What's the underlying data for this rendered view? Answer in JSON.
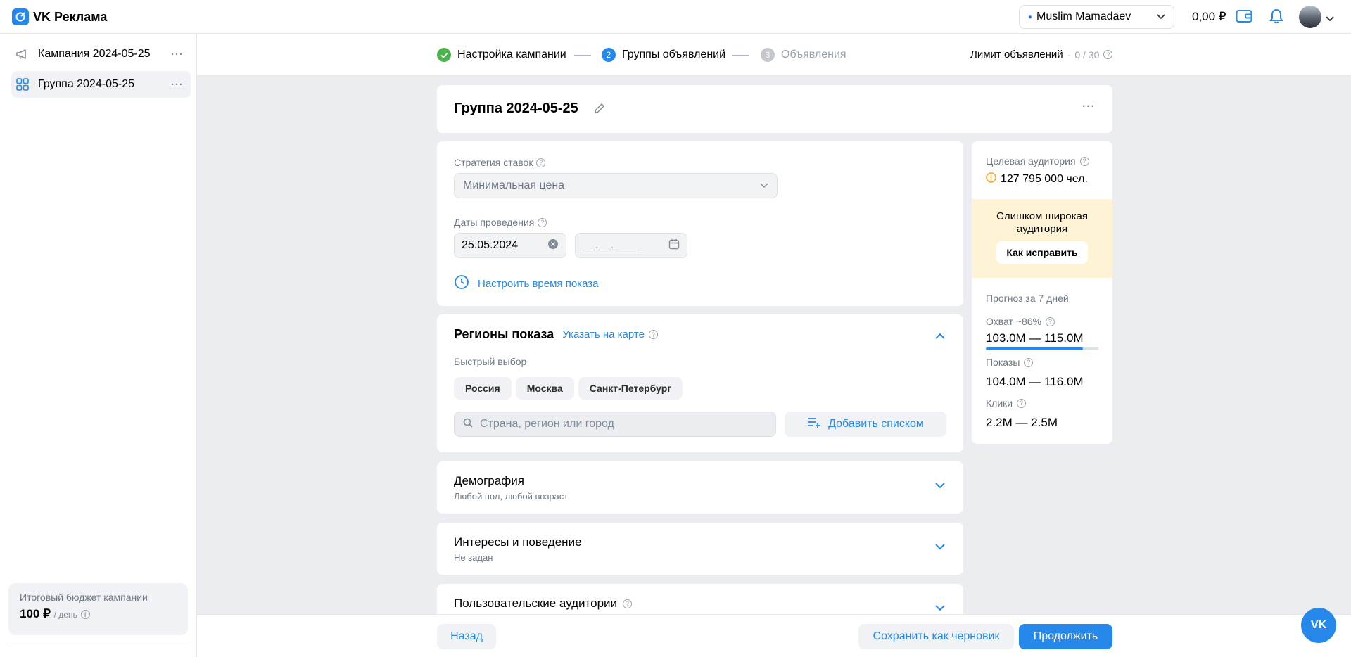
{
  "header": {
    "logo_text": "VK Реклама",
    "account_name": "Muslim Mamadaev",
    "balance": "0,00 ₽"
  },
  "sidebar": {
    "items": [
      {
        "label": "Кампания 2024-05-25",
        "icon": "megaphone-icon"
      },
      {
        "label": "Группа 2024-05-25",
        "icon": "grid-icon"
      }
    ],
    "budget_label": "Итоговый бюджет кампании",
    "budget_value": "100 ₽",
    "budget_period": "/ день"
  },
  "stepper": {
    "steps": [
      {
        "num": "",
        "label": "Настройка кампании",
        "state": "done"
      },
      {
        "num": "2",
        "label": "Группы объявлений",
        "state": "active"
      },
      {
        "num": "3",
        "label": "Объявления",
        "state": "pending"
      }
    ],
    "limit_label": "Лимит объявлений",
    "limit_sep": "·",
    "limit_value": "0 / 30"
  },
  "group": {
    "title": "Группа 2024-05-25"
  },
  "settings": {
    "bid_strategy_label": "Стратегия ставок",
    "bid_strategy_value": "Минимальная цена",
    "dates_label": "Даты проведения",
    "date_start": "25.05.2024",
    "date_end_placeholder": "__.__.____",
    "schedule_link": "Настроить время показа"
  },
  "regions": {
    "title": "Регионы показа",
    "map_link": "Указать на карте",
    "quick_label": "Быстрый выбор",
    "chips": [
      "Россия",
      "Москва",
      "Санкт-Петербург"
    ],
    "search_placeholder": "Страна, регион или город",
    "add_list": "Добавить списком"
  },
  "sections": [
    {
      "title": "Демография",
      "subtitle": "Любой пол, любой возраст"
    },
    {
      "title": "Интересы и поведение",
      "subtitle": "Не задан"
    },
    {
      "title": "Пользовательские аудитории",
      "subtitle": ""
    }
  ],
  "audience": {
    "label": "Целевая аудитория",
    "value": "127 795 000 чел.",
    "warning_text": "Слишком широкая аудитория",
    "fix_button": "Как исправить",
    "forecast_label": "Прогноз за 7 дней",
    "reach_label": "Охват ~86%",
    "reach_value": "103.0M — 115.0M",
    "reach_fraction": 0.86,
    "impressions_label": "Показы",
    "impressions_value": "104.0M — 116.0M",
    "clicks_label": "Клики",
    "clicks_value": "2.2M — 2.5M"
  },
  "footer": {
    "back": "Назад",
    "save_draft": "Сохранить как черновик",
    "continue": "Продолжить"
  },
  "fab": {
    "label": "VK"
  },
  "colors": {
    "accent": "#2688eb",
    "done": "#4bb34b",
    "warning_bg": "#fff3d6",
    "warning_icon": "#f5a623"
  }
}
